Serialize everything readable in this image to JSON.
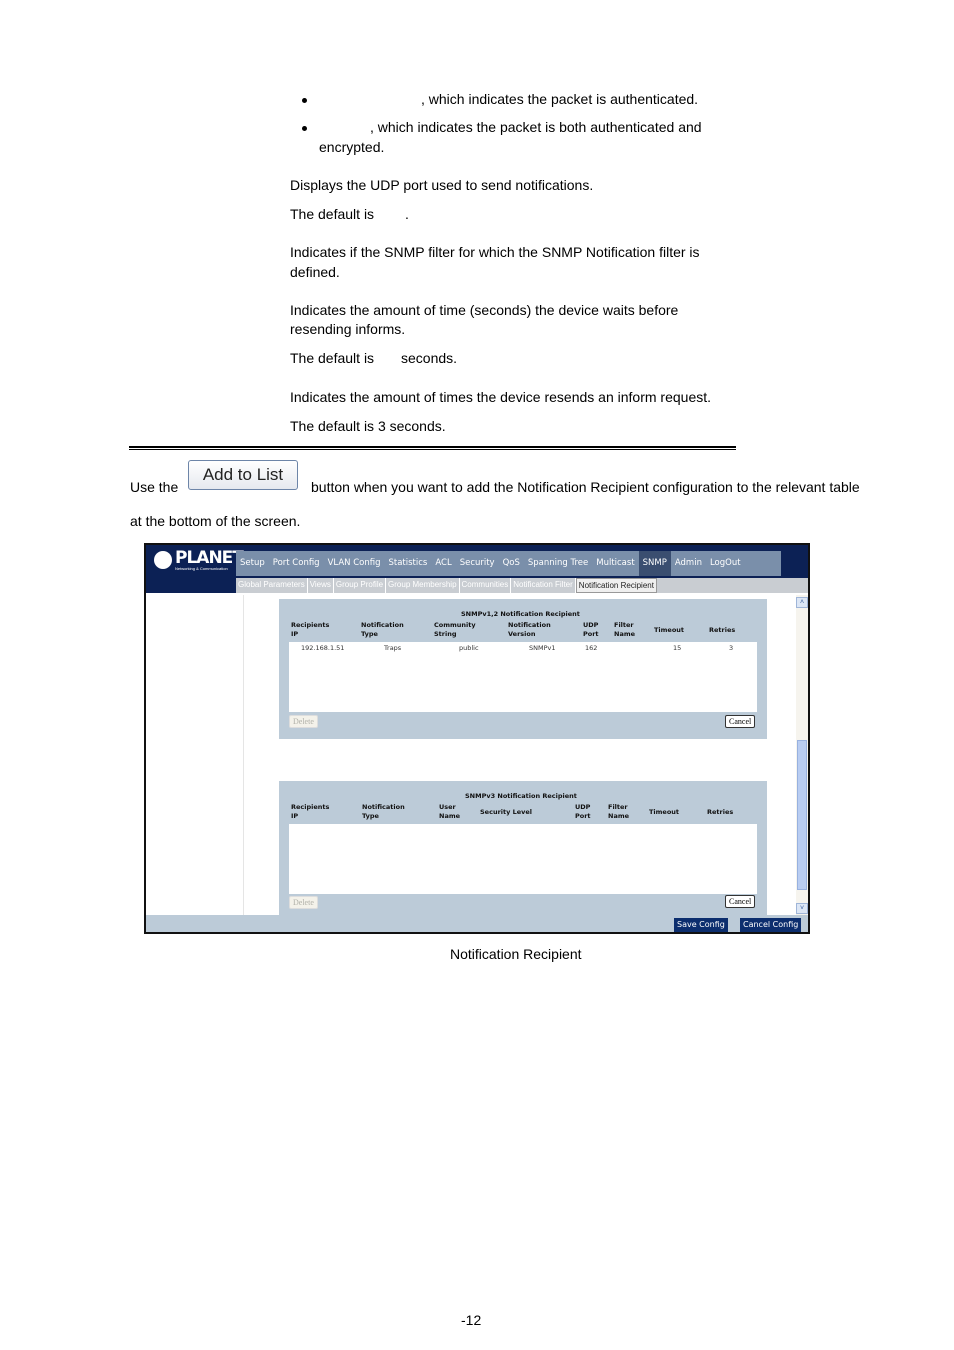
{
  "doc": {
    "bullets": [
      ", which indicates the packet is authenticated.",
      ", which indicates the packet is both authenticated and",
      "encrypted."
    ],
    "udp_desc": "Displays the UDP port used to send notifications.",
    "udp_default": "The default is",
    "udp_default_end": ".",
    "filter_desc_1": "Indicates if the SNMP filter for which the SNMP Notification filter is",
    "filter_desc_2": "defined.",
    "timeout_desc_1": "Indicates the amount of time (seconds) the device waits before",
    "timeout_desc_2": "resending informs.",
    "timeout_default": "The default is",
    "timeout_default_end": "seconds.",
    "retries_desc": "Indicates the amount of times the device resends an inform request.",
    "retries_default": "The default is 3 seconds.",
    "use_the": "Use the",
    "add_to_list_button": "Add to List",
    "use_after": "button when you want to add the Notification Recipient configuration to the relevant table",
    "use_line2": "at the bottom of the screen.",
    "caption": "Notification Recipient",
    "page_number": "-12"
  },
  "app": {
    "logo_text": "PLANET",
    "logo_sub": "Networking & Communication",
    "main_nav": [
      "Setup",
      "Port Config",
      "VLAN Config",
      "Statistics",
      "ACL",
      "Security",
      "QoS",
      "Spanning Tree",
      "Multicast",
      "SNMP",
      "Admin",
      "LogOut"
    ],
    "main_nav_active": "SNMP",
    "sub_nav": [
      "Global Parameters",
      "Views",
      "Group Profile",
      "Group Membership",
      "Communities",
      "Notification Filter",
      "Notification Recipient"
    ],
    "sub_nav_active": "Notification Recipient",
    "v12": {
      "title": "SNMPv1,2 Notification Recipient",
      "columns": [
        "Recipients\nIP",
        "Notification\nType",
        "Community\nString",
        "Notification\nVersion",
        "UDP\nPort",
        "Filter\nName",
        "Timeout",
        "Retries"
      ],
      "rows": [
        [
          "192.168.1.51",
          "Traps",
          "public",
          "SNMPv1",
          "162",
          "",
          "15",
          "3"
        ]
      ],
      "delete_button": "Delete",
      "cancel_button": "Cancel"
    },
    "v3": {
      "title": "SNMPv3 Notification Recipient",
      "columns": [
        "Recipients\nIP",
        "Notification\nType",
        "User\nName",
        "Security Level",
        "UDP\nPort",
        "Filter\nName",
        "Timeout",
        "Retries"
      ],
      "rows": [],
      "delete_button": "Delete",
      "cancel_button": "Cancel"
    },
    "save_config": "Save Config",
    "cancel_config": "Cancel Config",
    "scroll_up": "˄",
    "scroll_down": "˅"
  }
}
